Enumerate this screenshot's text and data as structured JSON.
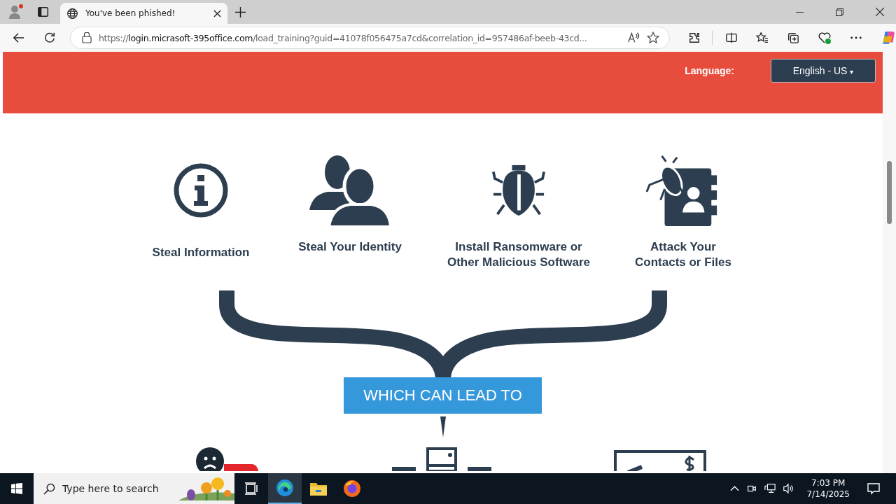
{
  "browser": {
    "tab": {
      "title": "You've been phished!",
      "selected": true
    },
    "url": {
      "scheme": "https://",
      "host": "login.micrasoft-395office.com",
      "path": "/load_training?guid=41078f056475a7cd&correlation_id=957486af-beeb-43cd..."
    }
  },
  "header": {
    "language_label": "Language:",
    "language_value": "English - US",
    "caret": "▾"
  },
  "threats": [
    {
      "kind": "info",
      "label": "Steal Information"
    },
    {
      "kind": "people",
      "label": "Steal Your Identity"
    },
    {
      "kind": "bug",
      "label": "Install Ransomware or Other Malicious Software"
    },
    {
      "kind": "contacts",
      "label": "Attack Your Contacts or Files"
    }
  ],
  "lead_box": "WHICH CAN LEAD TO",
  "taskbar": {
    "search_placeholder": "Type here to search",
    "time": "7:03 PM",
    "date": "7/14/2025"
  }
}
